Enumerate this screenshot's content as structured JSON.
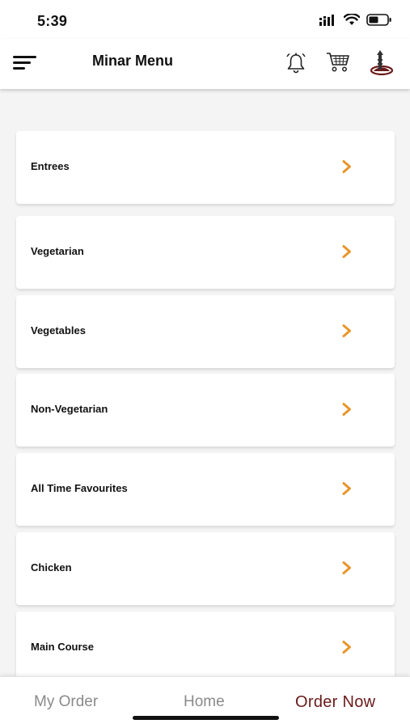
{
  "status_bar": {
    "time": "5:39"
  },
  "header": {
    "title": "Minar Menu"
  },
  "categories": [
    {
      "label": "Entrees"
    },
    {
      "label": "Vegetarian"
    },
    {
      "label": "Vegetables"
    },
    {
      "label": "Non-Vegetarian"
    },
    {
      "label": "All Time Favourites"
    },
    {
      "label": "Chicken"
    },
    {
      "label": "Main Course"
    }
  ],
  "bottom_nav": {
    "my_order": "My Order",
    "home": "Home",
    "order_now": "Order Now"
  },
  "colors": {
    "accent_chevron": "#e8952a",
    "brand": "#6a1a1a"
  },
  "icons": [
    "menu-icon",
    "bell-icon",
    "cart-icon",
    "restaurant-logo-icon",
    "chevron-right-icon",
    "signal-icon",
    "wifi-icon",
    "battery-icon"
  ]
}
